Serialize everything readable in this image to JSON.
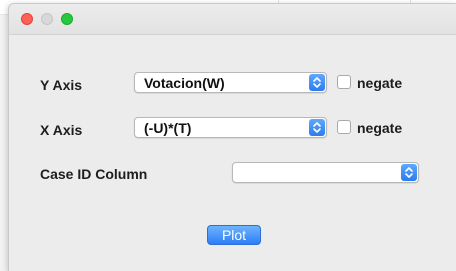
{
  "dialog": {
    "y_axis": {
      "label": "Y Axis",
      "value": "Votacion(W)",
      "negate_label": "negate",
      "negate_checked": false
    },
    "x_axis": {
      "label": "X Axis",
      "value": "(-U)*(T)",
      "negate_label": "negate",
      "negate_checked": false
    },
    "case_id": {
      "label": "Case ID Column",
      "value": ""
    },
    "plot_label": "Plot"
  },
  "icons": {
    "close": "close-icon",
    "minimize": "minimize-icon",
    "zoom": "zoom-icon",
    "stepper": "chevron-updown-icon"
  },
  "colors": {
    "accent": "#2f7df5",
    "close": "#fe5f57",
    "zoom": "#27c840",
    "minimize_disabled": "#d8d8d8"
  }
}
